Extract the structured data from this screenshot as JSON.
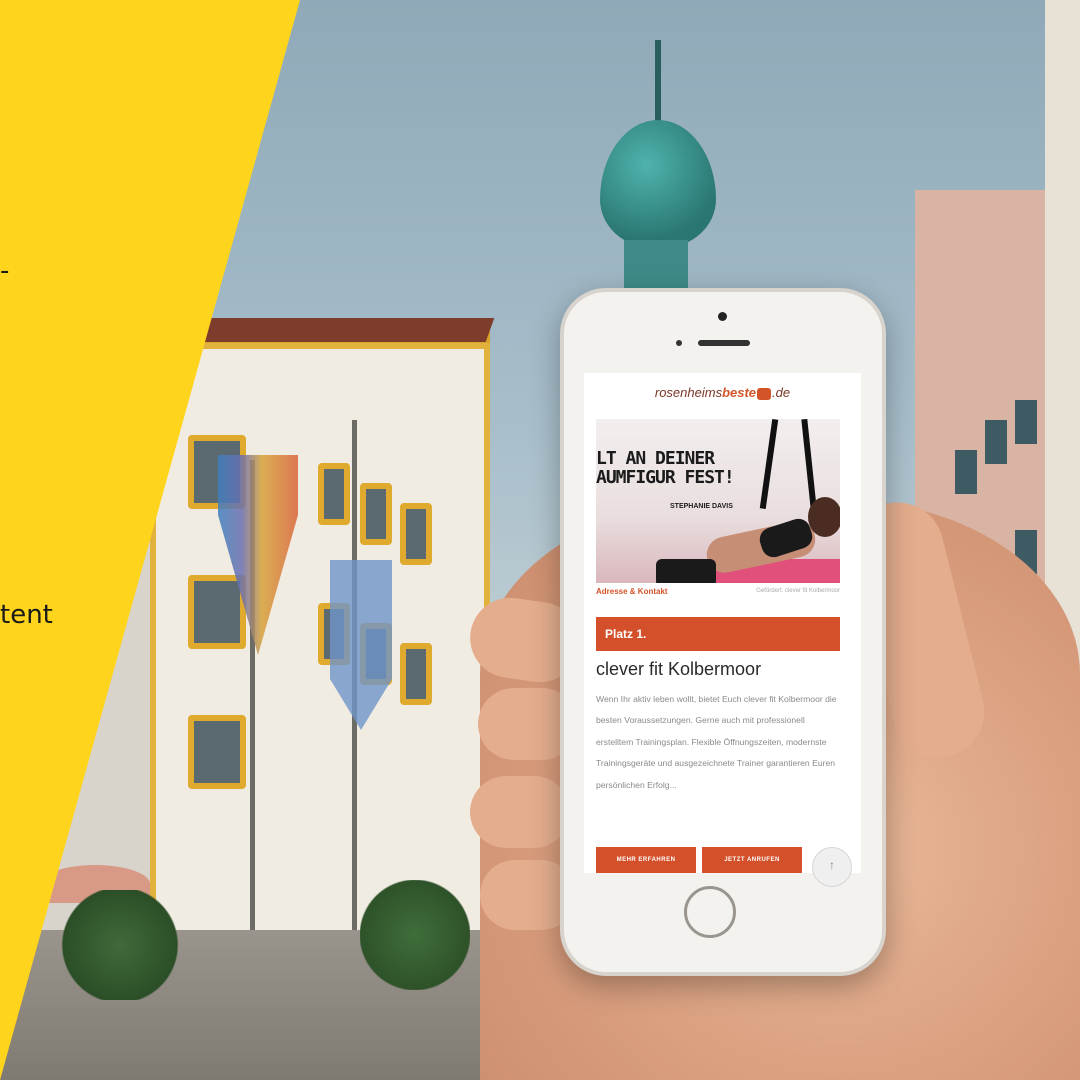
{
  "banner": {
    "partial_word": "tent",
    "dash": "-"
  },
  "website": {
    "logo_part1": "rosenheims",
    "logo_part2": "beste",
    "logo_part3": ".de",
    "hero_line1": "LT AN DEINER",
    "hero_line2": "AUMFIGUR FEST!",
    "hero_author": "STEPHANIE DAVIS",
    "address_link": "Adresse & Kontakt",
    "photo_credit": "Gefördert: clever fit Kolbermoor",
    "rank_label": "Platz 1.",
    "listing_title": "clever fit Kolbermoor",
    "description": "Wenn Ihr aktiv leben wollt, bietet Euch clever fit Kolbermoor die besten Voraussetzungen. Gerne auch mit professionell erstelltem Trainingsplan. Flexible Öffnungszeiten, modernste Trainingsgeräte und ausgezeichnete Trainer garantieren Euren persönlichen Erfolg...",
    "btn_more": "MEHR ERFAHREN",
    "btn_call": "JETZT ANRUFEN",
    "scroll_top_icon": "↑"
  },
  "colors": {
    "banner_yellow": "#ffd41c",
    "accent_orange": "#d4502a",
    "logo_brown": "#7a3626"
  }
}
